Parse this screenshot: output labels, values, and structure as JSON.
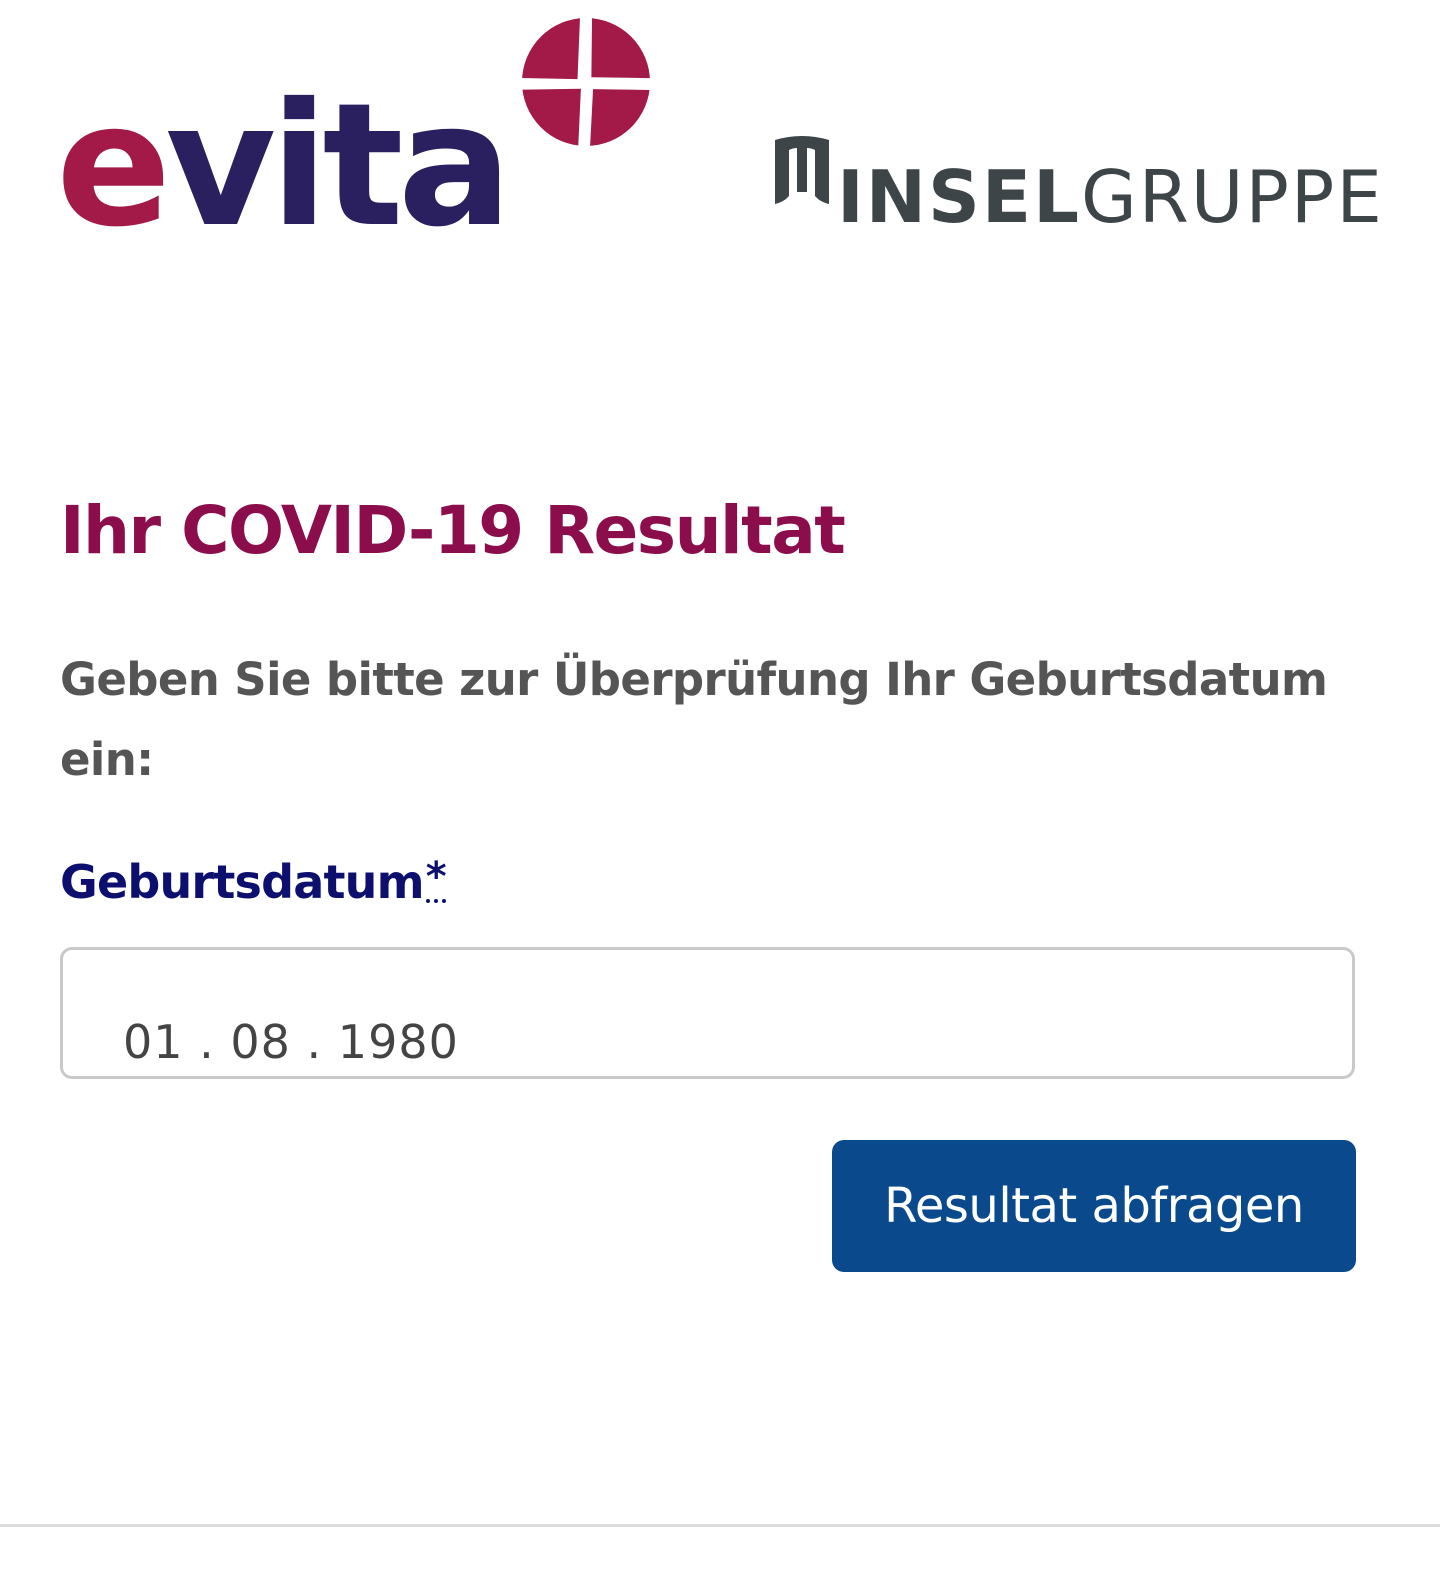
{
  "header": {
    "left_logo": {
      "wordmark": "evita",
      "icon": "cross-circle-logo-icon",
      "colors": {
        "primary": "#a31a48",
        "secondary": "#2a2060"
      }
    },
    "right_logo": {
      "wordmark_bold": "INSEL",
      "wordmark_light": "GRUPPE",
      "icon": "insel-pillar-logo-icon",
      "color": "#3d4548"
    }
  },
  "main": {
    "title": "Ihr COVID-19 Resultat",
    "instruction": "Geben Sie bitte zur Überprüfung Ihr Geburtsdatum ein:",
    "birthdate_field": {
      "label": "Geburtsdatum",
      "required_mark": "*",
      "value": "01 . 08 . 1980"
    },
    "submit_label": "Resultat abfragen"
  },
  "colors": {
    "title": "#8b0d4c",
    "label": "#0d0f6e",
    "body_text": "#555555",
    "button_bg": "#0a4a8c",
    "button_text": "#ffffff"
  }
}
